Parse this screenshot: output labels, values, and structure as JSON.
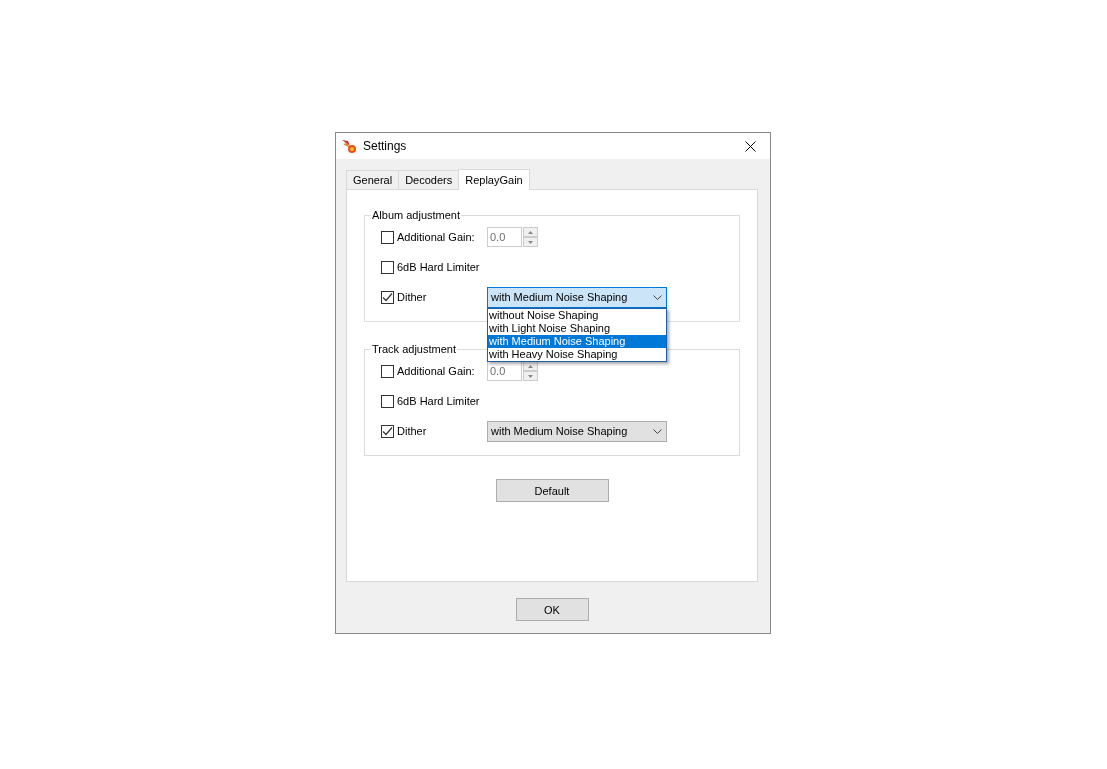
{
  "window": {
    "title": "Settings"
  },
  "tabs": [
    {
      "label": "General",
      "selected": false
    },
    {
      "label": "Decoders",
      "selected": false
    },
    {
      "label": "ReplayGain",
      "selected": true
    }
  ],
  "groups": [
    {
      "title": "Album adjustment",
      "rows": [
        {
          "kind": "spin",
          "label": "Additional Gain:",
          "checked": false,
          "value": "0.0",
          "disabled": true
        },
        {
          "kind": "check",
          "label": "6dB Hard Limiter",
          "checked": false
        },
        {
          "kind": "select",
          "label": "Dither",
          "checked": true,
          "value": "with Medium Noise Shaping",
          "expanded": true,
          "options": [
            {
              "label": "without Noise Shaping",
              "selected": false
            },
            {
              "label": "with Light Noise Shaping",
              "selected": false
            },
            {
              "label": "with Medium Noise Shaping",
              "selected": true
            },
            {
              "label": "with Heavy Noise Shaping",
              "selected": false
            }
          ]
        }
      ]
    },
    {
      "title": "Track adjustment",
      "rows": [
        {
          "kind": "spin",
          "label": "Additional Gain:",
          "checked": false,
          "value": "0.0",
          "disabled": true
        },
        {
          "kind": "check",
          "label": "6dB Hard Limiter",
          "checked": false
        },
        {
          "kind": "select",
          "label": "Dither",
          "checked": true,
          "value": "with Medium Noise Shaping",
          "expanded": false
        }
      ]
    }
  ],
  "default_button": "Default",
  "ok_button": "OK"
}
